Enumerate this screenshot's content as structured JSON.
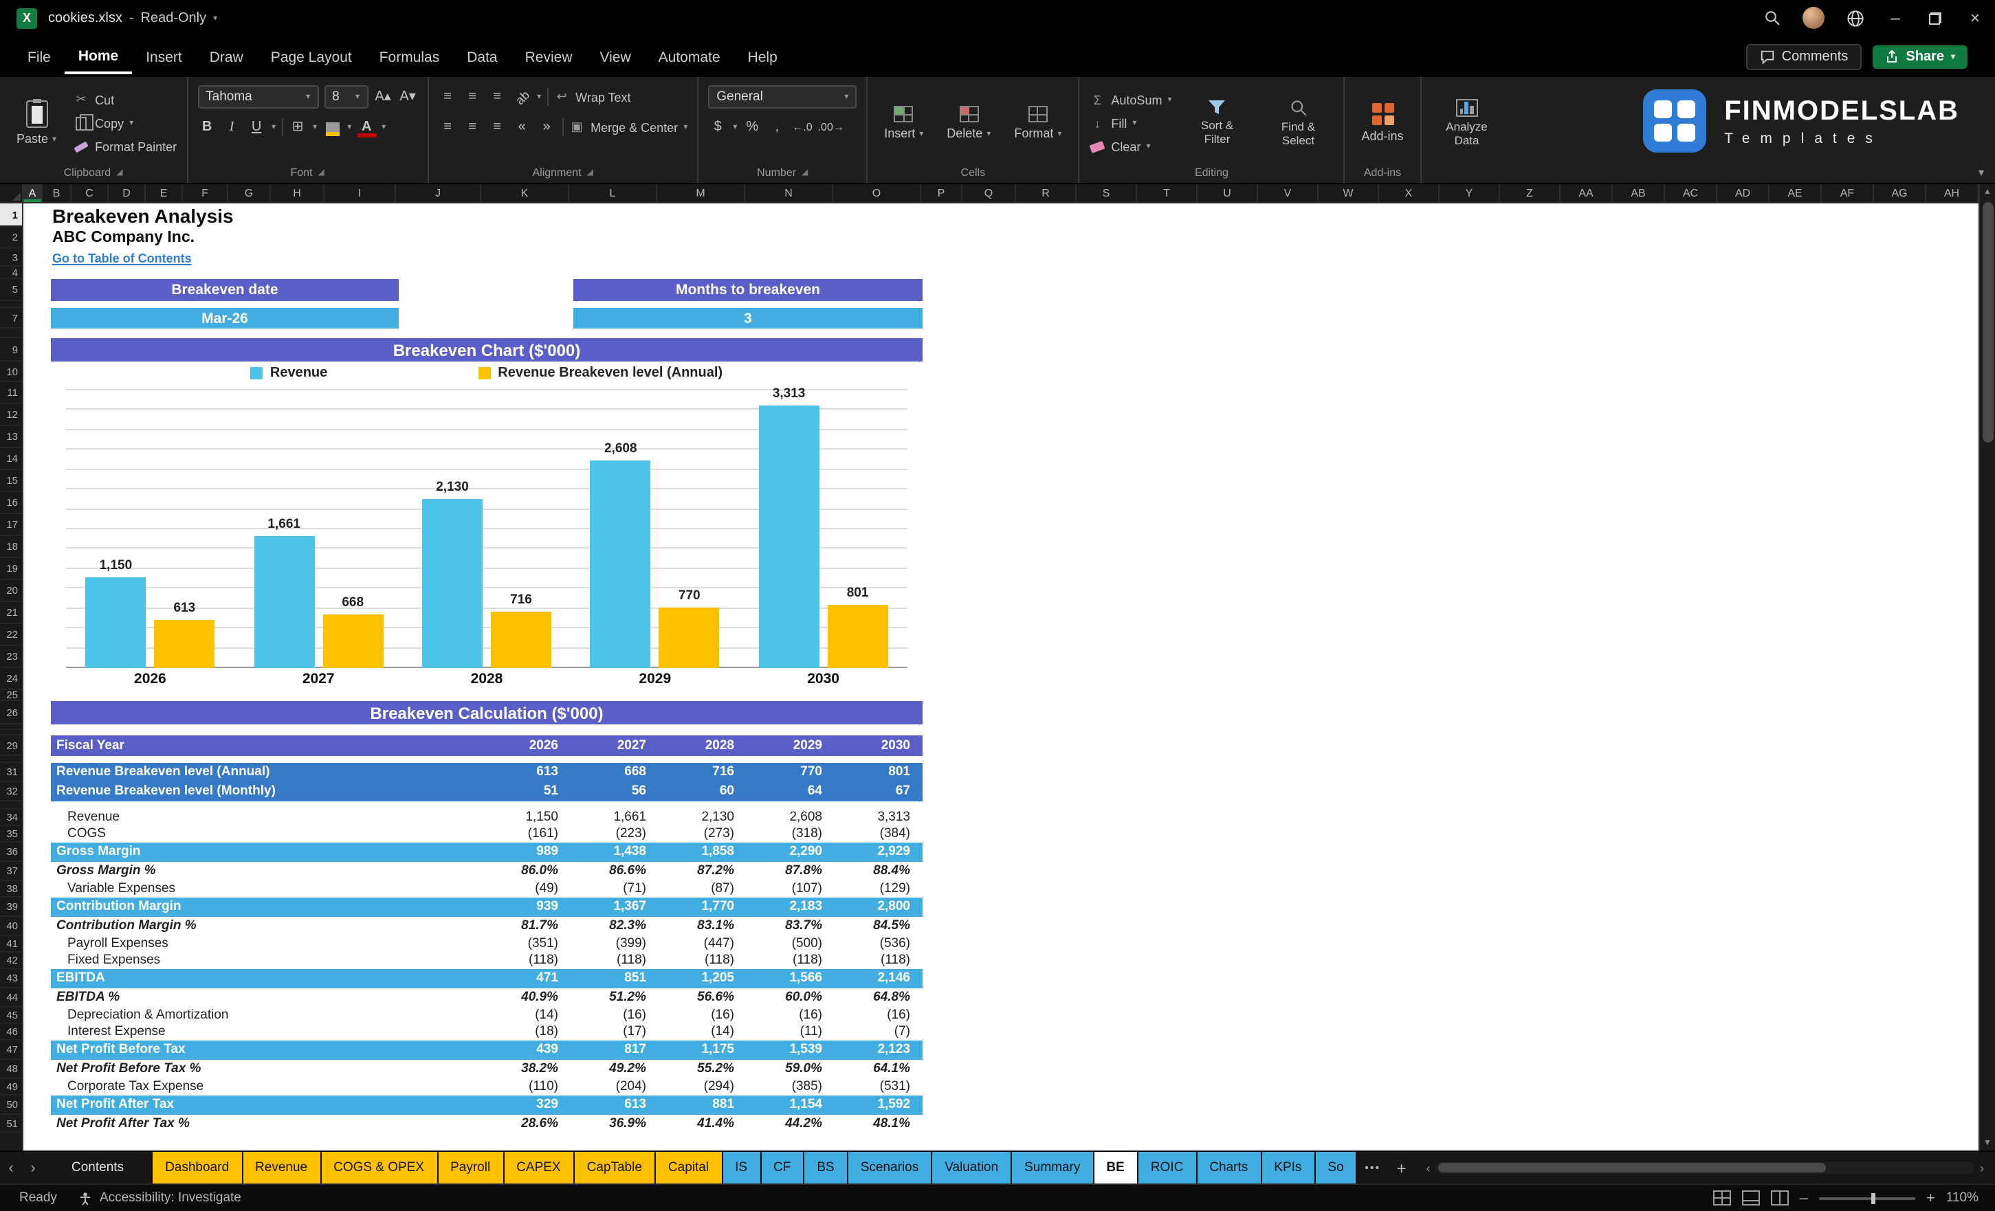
{
  "palette": {
    "purple": "#5A5EC7",
    "cyan": "#41ADE0",
    "medium_blue": "#3679C6",
    "chart_blue": "#4EC3E8",
    "chart_yellow": "#FFC000",
    "link_blue": "#2E7CD6",
    "tab_yellow": "#FFC000",
    "share_green": "#0F7B40",
    "excel_green": "#107C41"
  },
  "icons": {
    "search": "magnifier",
    "close": "×",
    "minimize": "–",
    "chevron-down": "▾",
    "autosum": "Σ",
    "cut": "✂",
    "scroll-left": "‹",
    "scroll-right": "›"
  },
  "titlebar": {
    "doc_name": "cookies.xlsx",
    "separator": "-",
    "doc_status": "Read-Only"
  },
  "menubar": {
    "items": [
      "File",
      "Home",
      "Insert",
      "Draw",
      "Page Layout",
      "Formulas",
      "Data",
      "Review",
      "View",
      "Automate",
      "Help"
    ],
    "active": "Home",
    "comments_label": "Comments",
    "share_label": "Share"
  },
  "ribbon": {
    "paste": "Paste",
    "cut": "Cut",
    "copy": "Copy",
    "format_painter": "Format Painter",
    "font_name": "Tahoma",
    "font_size": "8",
    "wrap_text": "Wrap Text",
    "merge_center": "Merge & Center",
    "number_format": "General",
    "insert": "Insert",
    "delete": "Delete",
    "format": "Format",
    "autosum": "AutoSum",
    "fill": "Fill",
    "clear": "Clear",
    "sort_filter": "Sort & Filter",
    "find_select": "Find & Select",
    "addins": "Add-ins",
    "analyze_data": "Analyze Data",
    "groups": {
      "clipboard": "Clipboard",
      "font": "Font",
      "alignment": "Alignment",
      "number": "Number",
      "cells": "Cells",
      "editing": "Editing",
      "addins": "Add-ins"
    },
    "logo_title": "FINMODELSLAB",
    "logo_subtitle": "Templates"
  },
  "sheet": {
    "columns": [
      "A",
      "B",
      "C",
      "D",
      "E",
      "F",
      "G",
      "H",
      "I",
      "J",
      "K",
      "L",
      "M",
      "N",
      "O",
      "P",
      "Q",
      "R",
      "S",
      "T",
      "U",
      "V",
      "W",
      "X",
      "Y",
      "Z",
      "AA",
      "AB",
      "AC",
      "AD",
      "AE",
      "AF",
      "AG",
      "AH"
    ],
    "row_count": 51,
    "title": "Breakeven Analysis",
    "company": "ABC Company Inc.",
    "toc_link": "Go to Table of Contents",
    "breakeven_date_label": "Breakeven date",
    "breakeven_date_value": "Mar-26",
    "months_label": "Months to breakeven",
    "months_value": "3",
    "chart_header": "Breakeven Chart ($'000)",
    "calc_header": "Breakeven Calculation ($'000)"
  },
  "chart_data": {
    "type": "bar",
    "title": "Breakeven Chart ($'000)",
    "categories": [
      "2026",
      "2027",
      "2028",
      "2029",
      "2030"
    ],
    "series": [
      {
        "name": "Revenue",
        "color": "#4EC3E8",
        "values": [
          1150,
          1661,
          2130,
          2608,
          3313
        ],
        "labels": [
          "1,150",
          "1,661",
          "2,130",
          "2,608",
          "3,313"
        ]
      },
      {
        "name": "Revenue Breakeven level (Annual)",
        "color": "#FFC000",
        "values": [
          613,
          668,
          716,
          770,
          801
        ],
        "labels": [
          "613",
          "668",
          "716",
          "770",
          "801"
        ]
      }
    ],
    "ylim": [
      0,
      3500
    ],
    "gridline_step": 250,
    "grid": true,
    "legend_position": "top",
    "y_axis_labels_visible": false
  },
  "calc_table": {
    "header_label": "Fiscal Year",
    "years": [
      "2026",
      "2027",
      "2028",
      "2029",
      "2030"
    ],
    "rows": [
      {
        "label": "Revenue Breakeven level (Annual)",
        "values": [
          "613",
          "668",
          "716",
          "770",
          "801"
        ],
        "style": "blue"
      },
      {
        "label": "Revenue Breakeven level (Monthly)",
        "values": [
          "51",
          "56",
          "60",
          "64",
          "67"
        ],
        "style": "blue"
      },
      {
        "label": "Revenue",
        "values": [
          "1,150",
          "1,661",
          "2,130",
          "2,608",
          "3,313"
        ],
        "style": "detail"
      },
      {
        "label": "COGS",
        "values": [
          "(161)",
          "(223)",
          "(273)",
          "(318)",
          "(384)"
        ],
        "style": "detail"
      },
      {
        "label": "Gross Margin",
        "values": [
          "989",
          "1,438",
          "1,858",
          "2,290",
          "2,929"
        ],
        "style": "cyan"
      },
      {
        "label": "Gross Margin %",
        "values": [
          "86.0%",
          "86.6%",
          "87.2%",
          "87.8%",
          "88.4%"
        ],
        "style": "pct"
      },
      {
        "label": "Variable Expenses",
        "values": [
          "(49)",
          "(71)",
          "(87)",
          "(107)",
          "(129)"
        ],
        "style": "detail"
      },
      {
        "label": "Contribution Margin",
        "values": [
          "939",
          "1,367",
          "1,770",
          "2,183",
          "2,800"
        ],
        "style": "cyan"
      },
      {
        "label": "Contribution Margin %",
        "values": [
          "81.7%",
          "82.3%",
          "83.1%",
          "83.7%",
          "84.5%"
        ],
        "style": "pct"
      },
      {
        "label": "Payroll Expenses",
        "values": [
          "(351)",
          "(399)",
          "(447)",
          "(500)",
          "(536)"
        ],
        "style": "detail"
      },
      {
        "label": "Fixed Expenses",
        "values": [
          "(118)",
          "(118)",
          "(118)",
          "(118)",
          "(118)"
        ],
        "style": "detail"
      },
      {
        "label": "EBITDA",
        "values": [
          "471",
          "851",
          "1,205",
          "1,566",
          "2,146"
        ],
        "style": "cyan"
      },
      {
        "label": "EBITDA %",
        "values": [
          "40.9%",
          "51.2%",
          "56.6%",
          "60.0%",
          "64.8%"
        ],
        "style": "pct"
      },
      {
        "label": "Depreciation & Amortization",
        "values": [
          "(14)",
          "(16)",
          "(16)",
          "(16)",
          "(16)"
        ],
        "style": "detail"
      },
      {
        "label": "Interest Expense",
        "values": [
          "(18)",
          "(17)",
          "(14)",
          "(11)",
          "(7)"
        ],
        "style": "detail"
      },
      {
        "label": "Net Profit Before Tax",
        "values": [
          "439",
          "817",
          "1,175",
          "1,539",
          "2,123"
        ],
        "style": "cyan"
      },
      {
        "label": "Net Profit Before Tax %",
        "values": [
          "38.2%",
          "49.2%",
          "55.2%",
          "59.0%",
          "64.1%"
        ],
        "style": "pct"
      },
      {
        "label": "Corporate Tax Expense",
        "values": [
          "(110)",
          "(204)",
          "(294)",
          "(385)",
          "(531)"
        ],
        "style": "detail"
      },
      {
        "label": "Net Profit After Tax",
        "values": [
          "329",
          "613",
          "881",
          "1,154",
          "1,592"
        ],
        "style": "cyan"
      },
      {
        "label": "Net Profit After Tax %",
        "values": [
          "28.6%",
          "36.9%",
          "41.4%",
          "44.2%",
          "48.1%"
        ],
        "style": "pct"
      }
    ]
  },
  "tabs": {
    "items": [
      {
        "label": "Contents",
        "style": "plain"
      },
      {
        "label": "Dashboard",
        "style": "yellow"
      },
      {
        "label": "Revenue",
        "style": "yellow"
      },
      {
        "label": "COGS & OPEX",
        "style": "yellow"
      },
      {
        "label": "Payroll",
        "style": "yellow"
      },
      {
        "label": "CAPEX",
        "style": "yellow"
      },
      {
        "label": "CapTable",
        "style": "yellow"
      },
      {
        "label": "Capital",
        "style": "yellow"
      },
      {
        "label": "IS",
        "style": "cyan"
      },
      {
        "label": "CF",
        "style": "cyan"
      },
      {
        "label": "BS",
        "style": "cyan"
      },
      {
        "label": "Scenarios",
        "style": "cyan"
      },
      {
        "label": "Valuation",
        "style": "cyan"
      },
      {
        "label": "Summary",
        "style": "cyan"
      },
      {
        "label": "BE",
        "style": "active"
      },
      {
        "label": "ROIC",
        "style": "cyan"
      },
      {
        "label": "Charts",
        "style": "cyan"
      },
      {
        "label": "KPIs",
        "style": "cyan"
      },
      {
        "label": "So",
        "style": "cyan"
      }
    ],
    "more": "•••",
    "add": "+"
  },
  "statusbar": {
    "ready": "Ready",
    "accessibility": "Accessibility: Investigate",
    "zoom": "110%"
  }
}
